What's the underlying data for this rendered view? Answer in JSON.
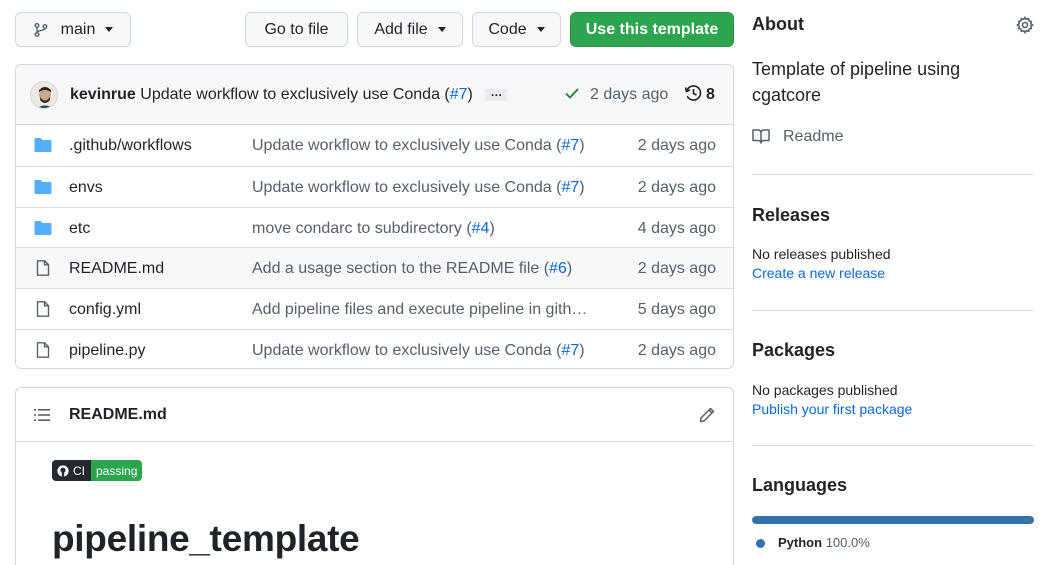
{
  "toolbar": {
    "branch": "main",
    "go_to_file": "Go to file",
    "add_file": "Add file",
    "code": "Code",
    "use_template": "Use this template"
  },
  "commit": {
    "author": "kevinrue",
    "message": "Update workflow to exclusively use Conda (",
    "pr": "#7",
    "message_end": ")",
    "ellipsis": "…",
    "time": "2 days ago",
    "history_count": "8"
  },
  "files": [
    {
      "name": ".github/workflows",
      "type": "folder",
      "msg": "Update workflow to exclusively use Conda (",
      "pr": "#7",
      "msg_end": ")",
      "time": "2 days ago"
    },
    {
      "name": "envs",
      "type": "folder",
      "msg": "Update workflow to exclusively use Conda (",
      "pr": "#7",
      "msg_end": ")",
      "time": "2 days ago"
    },
    {
      "name": "etc",
      "type": "folder",
      "msg": "move condarc to subdirectory (",
      "pr": "#4",
      "msg_end": ")",
      "time": "4 days ago"
    },
    {
      "name": "README.md",
      "type": "file",
      "msg": "Add a usage section to the README file (",
      "pr": "#6",
      "msg_end": ")",
      "time": "2 days ago"
    },
    {
      "name": "config.yml",
      "type": "file",
      "msg": "Add pipeline files and execute pipeline in gith…",
      "pr": "",
      "msg_end": "",
      "time": "5 days ago"
    },
    {
      "name": "pipeline.py",
      "type": "file",
      "msg": "Update workflow to exclusively use Conda (",
      "pr": "#7",
      "msg_end": ")",
      "time": "2 days ago"
    }
  ],
  "readme": {
    "title": "README.md",
    "badge_left": "CI",
    "badge_right": "passing",
    "heading": "pipeline_template"
  },
  "sidebar": {
    "about_title": "About",
    "about_desc": "Template of pipeline using cgatcore",
    "readme_link": "Readme",
    "releases_title": "Releases",
    "releases_none": "No releases published",
    "releases_link": "Create a new release",
    "packages_title": "Packages",
    "packages_none": "No packages published",
    "packages_link": "Publish your first package",
    "languages_title": "Languages",
    "language_name": "Python",
    "language_pct": "100.0%",
    "language_color": "#3572A5"
  },
  "colors": {
    "primary_green": "#2da44e",
    "link_blue": "#0969da",
    "folder_blue": "#54aeff"
  }
}
